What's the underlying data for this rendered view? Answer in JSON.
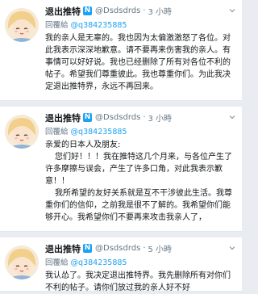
{
  "tweets": [
    {
      "display_name": "退出推特",
      "badge": "N",
      "handle": "@Dsdsdrds",
      "separator": "·",
      "time": "3 小時",
      "reply_label": "回覆給",
      "reply_to": "@q384235885",
      "paragraphs": [
        "我的亲人是无辜的。我也因为太偏激激怒了各位。对此我表示深深地歉意。请不要再来伤害我的亲人。有事情可以好好说。我也已经删除了所有对各位不利的帖子。希望我们尊重彼此。我也尊重你们。为此我决定退出推特界，永远不再回来。"
      ]
    },
    {
      "display_name": "退出推特",
      "badge": "N",
      "handle": "@Dsdsdrds",
      "separator": "·",
      "time": "3 小時",
      "reply_label": "回覆給",
      "reply_to": "@q384235885",
      "paragraphs": [
        "亲爱的日本人及朋友:",
        "您们好！！！我在推特这几个月来，与各位产生了许多摩擦与误会，产生了许多口角，对此我表示歉意！！",
        "我所希望的友好关系就是互不干涉彼此生活。我尊重你们的信仰，之前我是很不了解的。我希望你们能够开心。我希望你们不要再来攻击我亲人了，"
      ]
    },
    {
      "display_name": "退出推特",
      "badge": "N",
      "handle": "@Dsdsdrds",
      "separator": "·",
      "time": "5 小時",
      "reply_label": "回覆給",
      "reply_to": "@q384235885",
      "paragraphs": [
        "我认怂了。我决定退出推特界。我先删除所有对你们不利的帖子。请你们放过我的亲人好不好"
      ]
    }
  ]
}
